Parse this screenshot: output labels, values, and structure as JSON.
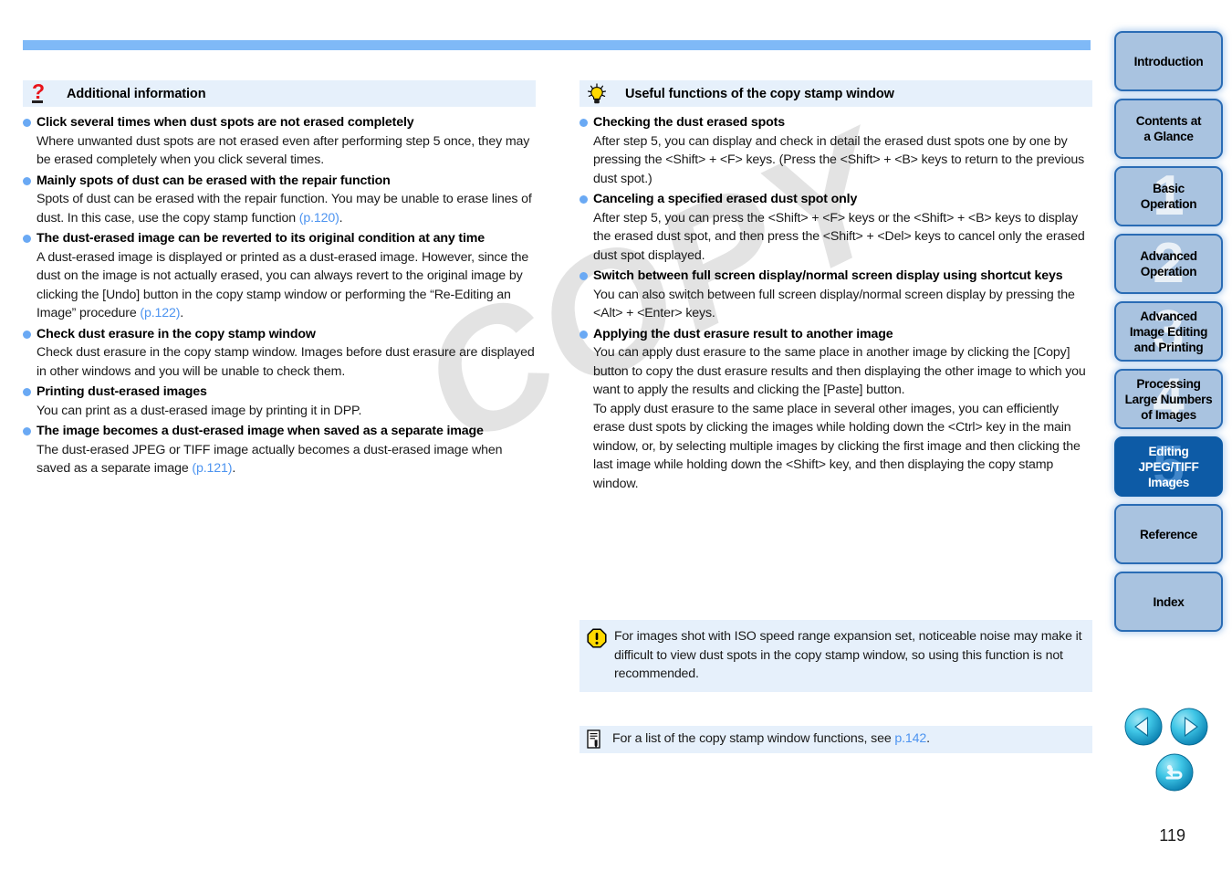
{
  "page": {
    "number": "119",
    "watermark": "COPY"
  },
  "left_column": {
    "heading": {
      "icon": "question-mark-icon",
      "title": "Additional information"
    },
    "items": [
      {
        "title": "Click several times when dust spots are not erased completely",
        "body": "Where unwanted dust spots are not erased even after performing step 5 once, they may be erased completely when you click several times."
      },
      {
        "title": "Mainly spots of dust can be erased with the repair function",
        "body_pre": "Spots of dust can be erased with the repair function. You may be unable to erase lines of dust. In this case, use the copy stamp function ",
        "link": "(p.120)",
        "body_post": "."
      },
      {
        "title": "The dust-erased image can be reverted to its original condition at any time",
        "body_pre": "A dust-erased image is displayed or printed as a dust-erased image. However, since the dust on the image is not actually erased, you can always revert to the original image by clicking the [Undo] button in the copy stamp window or performing the “Re-Editing an Image” procedure ",
        "link": "(p.122)",
        "body_post": "."
      },
      {
        "title": "Check dust erasure in the copy stamp window",
        "body": "Check dust erasure in the copy stamp window. Images before dust erasure are displayed in other windows and you will be unable to check them."
      },
      {
        "title": "Printing dust-erased images",
        "body": "You can print as a dust-erased image by printing it in DPP."
      },
      {
        "title": "The image becomes a dust-erased image when saved as a separate image",
        "body_pre": "The dust-erased JPEG or TIFF image actually becomes a dust-erased image when saved as a separate image ",
        "link": "(p.121)",
        "body_post": "."
      }
    ]
  },
  "right_column": {
    "heading": {
      "icon": "lightbulb-icon",
      "title": "Useful functions of the copy stamp window"
    },
    "items": [
      {
        "title": "Checking the dust erased spots",
        "body": "After step 5, you can display and check in detail the erased dust spots one by one by pressing the <Shift> + <F> keys. (Press the <Shift> + <B> keys to return to the previous dust spot.)"
      },
      {
        "title": "Canceling a specified erased dust spot only",
        "body": "After step 5, you can press the <Shift> + <F> keys or the <Shift> + <B> keys to display the erased dust spot, and then press the <Shift> + <Del> keys to cancel only the erased dust spot displayed."
      },
      {
        "title": "Switch between full screen display/normal screen display using shortcut keys",
        "body": "You can also switch between full screen display/normal screen display by pressing the <Alt> + <Enter> keys."
      },
      {
        "title": "Applying the dust erasure result to another image",
        "body": "You can apply dust erasure to the same place in another image by clicking the [Copy] button to copy the dust erasure results and then displaying the other image to which you want to apply the results and clicking the [Paste] button.",
        "body2": "To apply dust erasure to the same place in several other images, you can efficiently erase dust spots by clicking the images while holding down the <Ctrl> key in the main window, or, by selecting multiple images by clicking the first image and then clicking the last image while holding down the <Shift> key, and then displaying the copy stamp window."
      }
    ],
    "warning_note": {
      "icon": "warning-icon",
      "text": "For images shot with ISO speed range expansion set, noticeable noise may make it difficult to view dust spots in the copy stamp window, so using this function is not recommended."
    },
    "info_note": {
      "icon": "document-note-icon",
      "text_pre": "For a list of the copy stamp window functions, see ",
      "link": "p.142",
      "text_post": "."
    }
  },
  "sidebar": {
    "tabs": [
      {
        "label": "Introduction",
        "number": "",
        "active": false
      },
      {
        "label": "Contents at\na Glance",
        "number": "",
        "active": false
      },
      {
        "label": "Basic\nOperation",
        "number": "1",
        "active": false
      },
      {
        "label": "Advanced\nOperation",
        "number": "2",
        "active": false
      },
      {
        "label": "Advanced\nImage Editing\nand Printing",
        "number": "3",
        "active": false
      },
      {
        "label": "Processing\nLarge Numbers\nof Images",
        "number": "4",
        "active": false
      },
      {
        "label": "Editing\nJPEG/TIFF\nImages",
        "number": "5",
        "active": true
      },
      {
        "label": "Reference",
        "number": "",
        "active": false
      },
      {
        "label": "Index",
        "number": "",
        "active": false
      }
    ]
  },
  "nav_buttons": [
    {
      "name": "previous-page-button",
      "icon": "left-triangle-icon"
    },
    {
      "name": "next-page-button",
      "icon": "right-triangle-icon"
    },
    {
      "name": "return-button",
      "icon": "return-arrow-icon"
    }
  ],
  "colors": {
    "header_bar": "#7fb9f7",
    "section_head_bg": "#e6f0fb",
    "bullet": "#6aa9f4",
    "link": "#4d94f0",
    "tab_bg": "#a9c3e0",
    "tab_border": "#2a6cb5",
    "tab_active_bg": "#0d5ba6",
    "nav_button": "#19b5d9"
  }
}
